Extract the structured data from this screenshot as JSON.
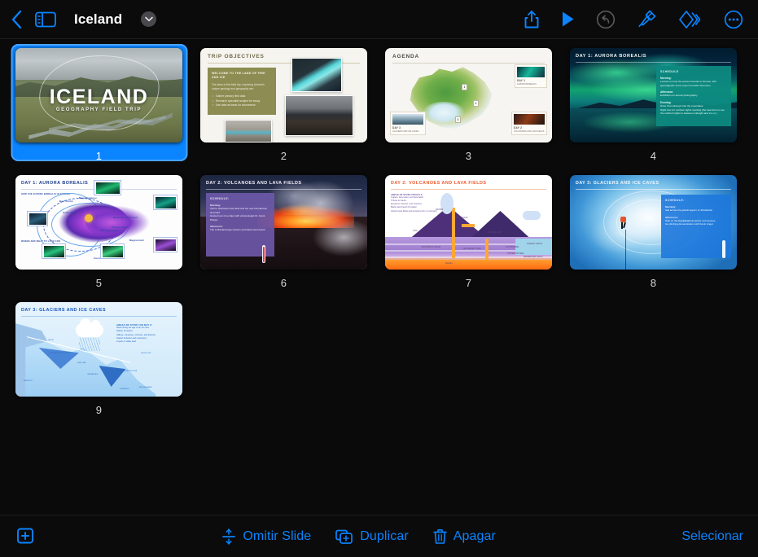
{
  "app": {
    "document_title": "Iceland",
    "accent_color": "#0a84ff"
  },
  "topbar": {
    "back_icon": "back-chevron-icon",
    "sidebar_icon": "sidebar-toggle-icon",
    "title": "Iceland",
    "title_chevron_icon": "chevron-down-icon",
    "actions": [
      {
        "name": "share-button",
        "icon": "share-up-arrow-icon",
        "enabled": true
      },
      {
        "name": "play-button",
        "icon": "play-triangle-icon",
        "enabled": true
      },
      {
        "name": "undo-button",
        "icon": "undo-arrow-icon",
        "enabled": false
      },
      {
        "name": "format-button",
        "icon": "paintbrush-icon",
        "enabled": true
      },
      {
        "name": "animate-button",
        "icon": "double-diamond-icon",
        "enabled": true
      },
      {
        "name": "more-button",
        "icon": "ellipsis-circle-icon",
        "enabled": true
      }
    ]
  },
  "slides": [
    {
      "number": "1",
      "selected": true,
      "title": "ICELAND",
      "subtitle": "GEOGRAPHY FIELD TRIP",
      "kind": "cover-photo"
    },
    {
      "number": "2",
      "selected": false,
      "title": "TRIP OBJECTIVES",
      "kind": "text-and-photos",
      "body_heading": "WELCOME TO THE LAND OF FIRE AND ICE",
      "body_text": "The aims of this field trip: exploring Iceland's unique geology and geography are:",
      "bullets": [
        "Gather primary field data",
        "Research specialist subject for essay",
        "Use data as basis for coursework"
      ]
    },
    {
      "number": "3",
      "selected": false,
      "title": "AGENDA",
      "kind": "map",
      "pins": [
        "1",
        "2",
        "3"
      ],
      "cards": [
        {
          "label": "DAY 1",
          "sub": "AURORA BOREALIS",
          "lines": [
            "Lecture on how the aurora is formed",
            "Exhibition on aurora photography",
            "Evening of northern lights"
          ]
        },
        {
          "label": "DAY 2",
          "sub": "VOLCANOES AND LAVA FIELDS",
          "lines": [
            "Visit to the Holuhraun lava field and Bardarbunga",
            "Trip to the Bardarbunga volcano and black sand beach"
          ]
        },
        {
          "label": "DAY 3",
          "sub": "GLACIERS AND ICE CAVES",
          "lines": [
            "Sail across the glacial lagoon",
            "Hike on the Eyjafjallajokull glacier"
          ]
        }
      ]
    },
    {
      "number": "4",
      "selected": false,
      "title": "DAY 1: AURORA BOREALIS",
      "kind": "photo-and-schedule",
      "schedule_heading": "SCHEDULE",
      "sections": [
        {
          "label": "Morning:",
          "items": [
            "Lecture on how the aurora borealis is formed, with geomagnetic storm expert Jennifer Sorenson"
          ]
        },
        {
          "label": "Afternoon:",
          "items": [
            "Exhibition on aurora photography"
          ]
        },
        {
          "label": "Evening:",
          "items": [
            "Drive from Akureyri into the mountains",
            "Night tour for northern lights spotting (the best time to see the northern lights is between midnight and 2 a.m.)"
          ]
        }
      ]
    },
    {
      "number": "5",
      "selected": false,
      "title": "DAY 1: AURORA BOREALIS",
      "kind": "diagram",
      "sub_headings": [
        "HOW THE AURORA BOREALIS IS FORMED",
        "WHERE AND WHAT TO LOOK FOR"
      ],
      "labels": [
        "Bow shock",
        "Magnetopause",
        "Solar wind",
        "Magnetic field lines",
        "Plasma sheet",
        "Van Allen belts",
        "Magnetotail",
        "Auroral ovals"
      ]
    },
    {
      "number": "6",
      "selected": false,
      "title": "DAY 2: VOLCANOES AND LAVA FIELDS",
      "kind": "photo-and-schedule",
      "schedule_heading": "SCHEDULE:",
      "sections": [
        {
          "label": "Morning:",
          "items": [
            "Visit to Holuhraun lava field and the new Nornahraun lava field",
            "Guided tour of a crater with volcanologist Dr. Grant Phelps"
          ]
        },
        {
          "label": "Afternoon:",
          "items": [
            "Trip to Bardarbunga volcano and black sand beach"
          ]
        }
      ],
      "temperature": "1000°F"
    },
    {
      "number": "7",
      "selected": false,
      "title": "DAY 2: VOLCANOES AND LAVA FIELDS",
      "kind": "diagram",
      "body_heading": "AREAS OF STUDY ON DAY 2:",
      "bullets": [
        "Craters, lava tubes, and lava fields",
        "Tribute to nature",
        "Eruptions, fissures, and structure",
        "Black sand beach formation",
        "Historic lava fields and tectonics form on the land"
      ],
      "labels": [
        "ASH CLOUD",
        "LAVA",
        "CRATER",
        "VOLCANIC ASH",
        "MAGMA",
        "SECONDARY CONE",
        "CONTINENTAL CRUST",
        "LITHOSPHERE",
        "OCEANIC CRUST",
        "ASTHENOSPHERE",
        "SEDIMENTARY ROCK"
      ]
    },
    {
      "number": "8",
      "selected": false,
      "title": "DAY 3: GLACIERS AND ICE CAVES",
      "kind": "photo-and-schedule",
      "schedule_heading": "SCHEDULE:",
      "sections": [
        {
          "label": "Morning:",
          "items": [
            "Sail across the glacial lagoon of Jökulsárlón"
          ]
        },
        {
          "label": "Afternoon:",
          "items": [
            "Hike on the Eyjafjallajökull glacier and icecave",
            "Ice climbing demonstration with Kevin Angel"
          ]
        }
      ],
      "temperature": "32°F"
    },
    {
      "number": "9",
      "selected": false,
      "title": "DAY 3: GLACIERS AND ICE CAVES",
      "kind": "diagram",
      "body_heading": "AREAS OF STUDY ON DAY 3:",
      "bullets": [
        "Determining the age of an ice cave",
        "Glacier formation",
        "Valleys, crevasses, cornices, and fissures",
        "Glacier behavior and movement",
        "Impact on wider land"
      ],
      "labels": [
        "ACCUMULATION ZONE",
        "ABLATION ZONE",
        "SNOW",
        "CREVASSES",
        "FIRN LINE",
        "TERMINUS",
        "BEDROCK",
        "SNOW LINE",
        "END MORAINE"
      ]
    }
  ],
  "bottombar": {
    "add_icon": "add-slide-icon",
    "actions": [
      {
        "name": "skip-slide-button",
        "label": "Omitir Slide",
        "icon": "skip-slide-icon"
      },
      {
        "name": "duplicate-button",
        "label": "Duplicar",
        "icon": "duplicate-icon"
      },
      {
        "name": "delete-button",
        "label": "Apagar",
        "icon": "trash-icon"
      }
    ],
    "select_label": "Selecionar"
  }
}
